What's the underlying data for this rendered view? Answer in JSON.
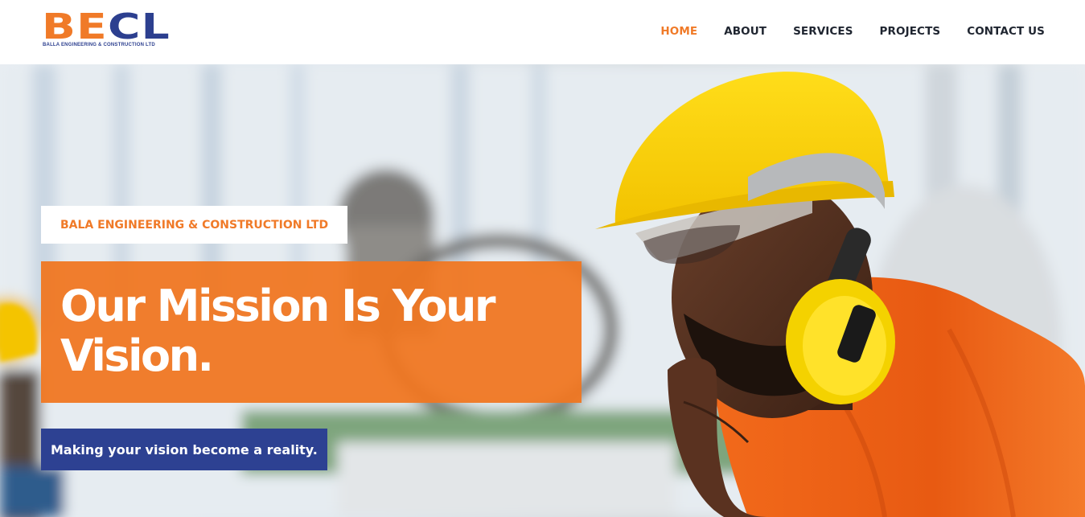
{
  "brand": {
    "logo_text": [
      "BE",
      "CL"
    ],
    "tagline": "BALLA ENGINEERING & CONSTRUCTION LTD",
    "colors": {
      "orange": "#f07a28",
      "navy": "#2c3f8f"
    }
  },
  "nav": {
    "items": [
      {
        "label": "HOME",
        "active": true
      },
      {
        "label": "ABOUT",
        "active": false
      },
      {
        "label": "SERVICES",
        "active": false
      },
      {
        "label": "PROJECTS",
        "active": false
      },
      {
        "label": "CONTACT US",
        "active": false
      }
    ]
  },
  "hero": {
    "eyebrow": "BALA ENGINEERING & CONSTRUCTION LTD",
    "headline": "Our Mission Is Your Vision.",
    "tagline": "Making your vision become a reality.",
    "image": "engineer-with-hard-hat-and-ear-protection"
  }
}
